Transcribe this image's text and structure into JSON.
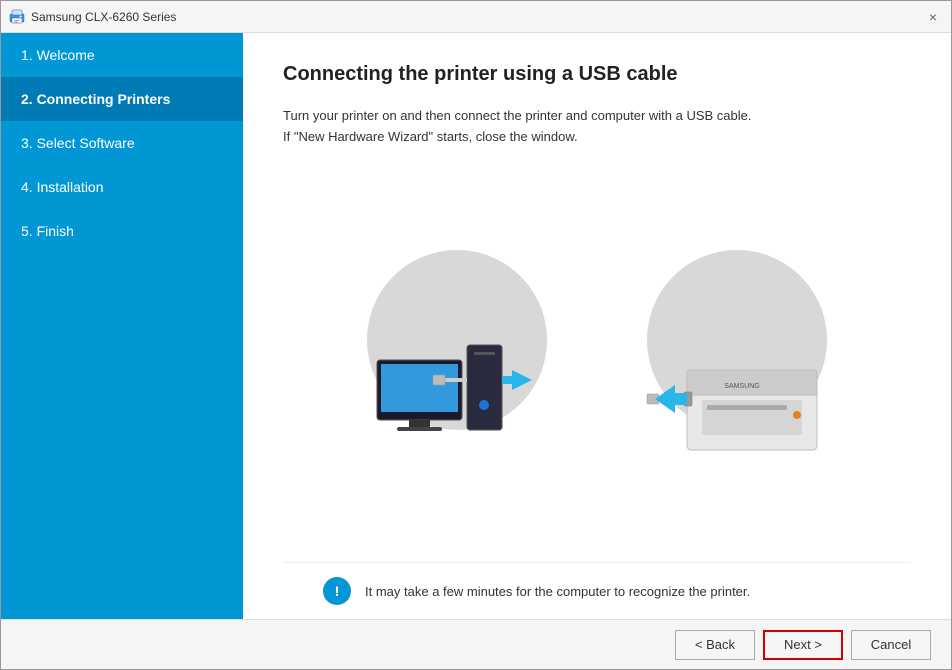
{
  "window": {
    "title": "Samsung CLX-6260 Series",
    "close_label": "×"
  },
  "sidebar": {
    "items": [
      {
        "id": "welcome",
        "label": "1. Welcome",
        "active": false
      },
      {
        "id": "connecting-printers",
        "label": "2. Connecting Printers",
        "active": true
      },
      {
        "id": "select-software",
        "label": "3. Select Software",
        "active": false
      },
      {
        "id": "installation",
        "label": "4. Installation",
        "active": false
      },
      {
        "id": "finish",
        "label": "5. Finish",
        "active": false
      }
    ]
  },
  "content": {
    "title": "Connecting the printer using a USB cable",
    "description_line1": "Turn your printer on and then connect the printer and computer with a USB cable.",
    "description_line2": "If \"New Hardware Wizard\" starts, close the window.",
    "info_text": "It may take a few minutes for the computer to recognize the printer."
  },
  "footer": {
    "back_label": "< Back",
    "next_label": "Next >",
    "cancel_label": "Cancel"
  }
}
